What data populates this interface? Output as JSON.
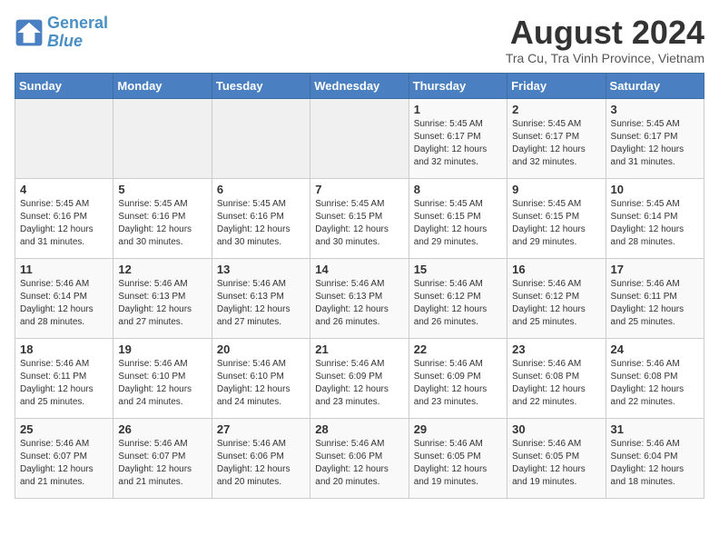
{
  "header": {
    "logo_line1": "General",
    "logo_line2": "Blue",
    "month_year": "August 2024",
    "location": "Tra Cu, Tra Vinh Province, Vietnam"
  },
  "days_of_week": [
    "Sunday",
    "Monday",
    "Tuesday",
    "Wednesday",
    "Thursday",
    "Friday",
    "Saturday"
  ],
  "weeks": [
    [
      {
        "day": "",
        "info": ""
      },
      {
        "day": "",
        "info": ""
      },
      {
        "day": "",
        "info": ""
      },
      {
        "day": "",
        "info": ""
      },
      {
        "day": "1",
        "info": "Sunrise: 5:45 AM\nSunset: 6:17 PM\nDaylight: 12 hours\nand 32 minutes."
      },
      {
        "day": "2",
        "info": "Sunrise: 5:45 AM\nSunset: 6:17 PM\nDaylight: 12 hours\nand 32 minutes."
      },
      {
        "day": "3",
        "info": "Sunrise: 5:45 AM\nSunset: 6:17 PM\nDaylight: 12 hours\nand 31 minutes."
      }
    ],
    [
      {
        "day": "4",
        "info": "Sunrise: 5:45 AM\nSunset: 6:16 PM\nDaylight: 12 hours\nand 31 minutes."
      },
      {
        "day": "5",
        "info": "Sunrise: 5:45 AM\nSunset: 6:16 PM\nDaylight: 12 hours\nand 30 minutes."
      },
      {
        "day": "6",
        "info": "Sunrise: 5:45 AM\nSunset: 6:16 PM\nDaylight: 12 hours\nand 30 minutes."
      },
      {
        "day": "7",
        "info": "Sunrise: 5:45 AM\nSunset: 6:15 PM\nDaylight: 12 hours\nand 30 minutes."
      },
      {
        "day": "8",
        "info": "Sunrise: 5:45 AM\nSunset: 6:15 PM\nDaylight: 12 hours\nand 29 minutes."
      },
      {
        "day": "9",
        "info": "Sunrise: 5:45 AM\nSunset: 6:15 PM\nDaylight: 12 hours\nand 29 minutes."
      },
      {
        "day": "10",
        "info": "Sunrise: 5:45 AM\nSunset: 6:14 PM\nDaylight: 12 hours\nand 28 minutes."
      }
    ],
    [
      {
        "day": "11",
        "info": "Sunrise: 5:46 AM\nSunset: 6:14 PM\nDaylight: 12 hours\nand 28 minutes."
      },
      {
        "day": "12",
        "info": "Sunrise: 5:46 AM\nSunset: 6:13 PM\nDaylight: 12 hours\nand 27 minutes."
      },
      {
        "day": "13",
        "info": "Sunrise: 5:46 AM\nSunset: 6:13 PM\nDaylight: 12 hours\nand 27 minutes."
      },
      {
        "day": "14",
        "info": "Sunrise: 5:46 AM\nSunset: 6:13 PM\nDaylight: 12 hours\nand 26 minutes."
      },
      {
        "day": "15",
        "info": "Sunrise: 5:46 AM\nSunset: 6:12 PM\nDaylight: 12 hours\nand 26 minutes."
      },
      {
        "day": "16",
        "info": "Sunrise: 5:46 AM\nSunset: 6:12 PM\nDaylight: 12 hours\nand 25 minutes."
      },
      {
        "day": "17",
        "info": "Sunrise: 5:46 AM\nSunset: 6:11 PM\nDaylight: 12 hours\nand 25 minutes."
      }
    ],
    [
      {
        "day": "18",
        "info": "Sunrise: 5:46 AM\nSunset: 6:11 PM\nDaylight: 12 hours\nand 25 minutes."
      },
      {
        "day": "19",
        "info": "Sunrise: 5:46 AM\nSunset: 6:10 PM\nDaylight: 12 hours\nand 24 minutes."
      },
      {
        "day": "20",
        "info": "Sunrise: 5:46 AM\nSunset: 6:10 PM\nDaylight: 12 hours\nand 24 minutes."
      },
      {
        "day": "21",
        "info": "Sunrise: 5:46 AM\nSunset: 6:09 PM\nDaylight: 12 hours\nand 23 minutes."
      },
      {
        "day": "22",
        "info": "Sunrise: 5:46 AM\nSunset: 6:09 PM\nDaylight: 12 hours\nand 23 minutes."
      },
      {
        "day": "23",
        "info": "Sunrise: 5:46 AM\nSunset: 6:08 PM\nDaylight: 12 hours\nand 22 minutes."
      },
      {
        "day": "24",
        "info": "Sunrise: 5:46 AM\nSunset: 6:08 PM\nDaylight: 12 hours\nand 22 minutes."
      }
    ],
    [
      {
        "day": "25",
        "info": "Sunrise: 5:46 AM\nSunset: 6:07 PM\nDaylight: 12 hours\nand 21 minutes."
      },
      {
        "day": "26",
        "info": "Sunrise: 5:46 AM\nSunset: 6:07 PM\nDaylight: 12 hours\nand 21 minutes."
      },
      {
        "day": "27",
        "info": "Sunrise: 5:46 AM\nSunset: 6:06 PM\nDaylight: 12 hours\nand 20 minutes."
      },
      {
        "day": "28",
        "info": "Sunrise: 5:46 AM\nSunset: 6:06 PM\nDaylight: 12 hours\nand 20 minutes."
      },
      {
        "day": "29",
        "info": "Sunrise: 5:46 AM\nSunset: 6:05 PM\nDaylight: 12 hours\nand 19 minutes."
      },
      {
        "day": "30",
        "info": "Sunrise: 5:46 AM\nSunset: 6:05 PM\nDaylight: 12 hours\nand 19 minutes."
      },
      {
        "day": "31",
        "info": "Sunrise: 5:46 AM\nSunset: 6:04 PM\nDaylight: 12 hours\nand 18 minutes."
      }
    ]
  ]
}
